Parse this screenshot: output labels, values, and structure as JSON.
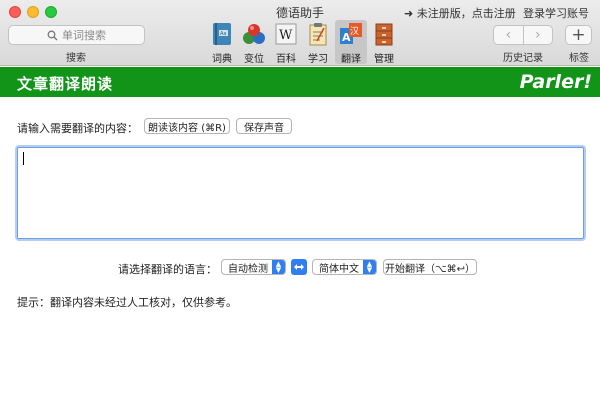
{
  "window": {
    "title": "德语助手"
  },
  "account": {
    "register_text": "➜ 未注册版，点击注册",
    "login_text": "登录学习账号"
  },
  "search": {
    "placeholder": "单词搜索",
    "caption": "搜索"
  },
  "toolbar": {
    "items": [
      {
        "label": "词典",
        "icon": "dictionary-book-icon",
        "active": false
      },
      {
        "label": "变位",
        "icon": "colored-balls-icon",
        "active": false
      },
      {
        "label": "百科",
        "icon": "wikipedia-w-icon",
        "active": false
      },
      {
        "label": "学习",
        "icon": "notepad-icon",
        "active": false
      },
      {
        "label": "翻译",
        "icon": "translate-icon",
        "active": true
      },
      {
        "label": "管理",
        "icon": "cabinet-icon",
        "active": false
      }
    ]
  },
  "history": {
    "caption": "历史记录",
    "back": "‹",
    "forward": "›"
  },
  "tags": {
    "caption": "标签",
    "add": "+"
  },
  "banner": {
    "title": "文章翻译朗读",
    "brand": "Parler!",
    "color": "#119418"
  },
  "reader": {
    "prompt": "请输入需要翻译的内容：",
    "read_button": "朗读该内容 (⌘R)",
    "save_button": "保存声音",
    "text": ""
  },
  "translation": {
    "prompt": "请选择翻译的语言：",
    "source_language": "自动检测",
    "target_language": "简体中文",
    "translate_button": "开始翻译（⌥⌘↩）"
  },
  "hint": "提示：翻译内容未经过人工核对，仅供参考。",
  "colors": {
    "accent": "#2f7ef2",
    "focus_border": "#6d9ee4"
  }
}
